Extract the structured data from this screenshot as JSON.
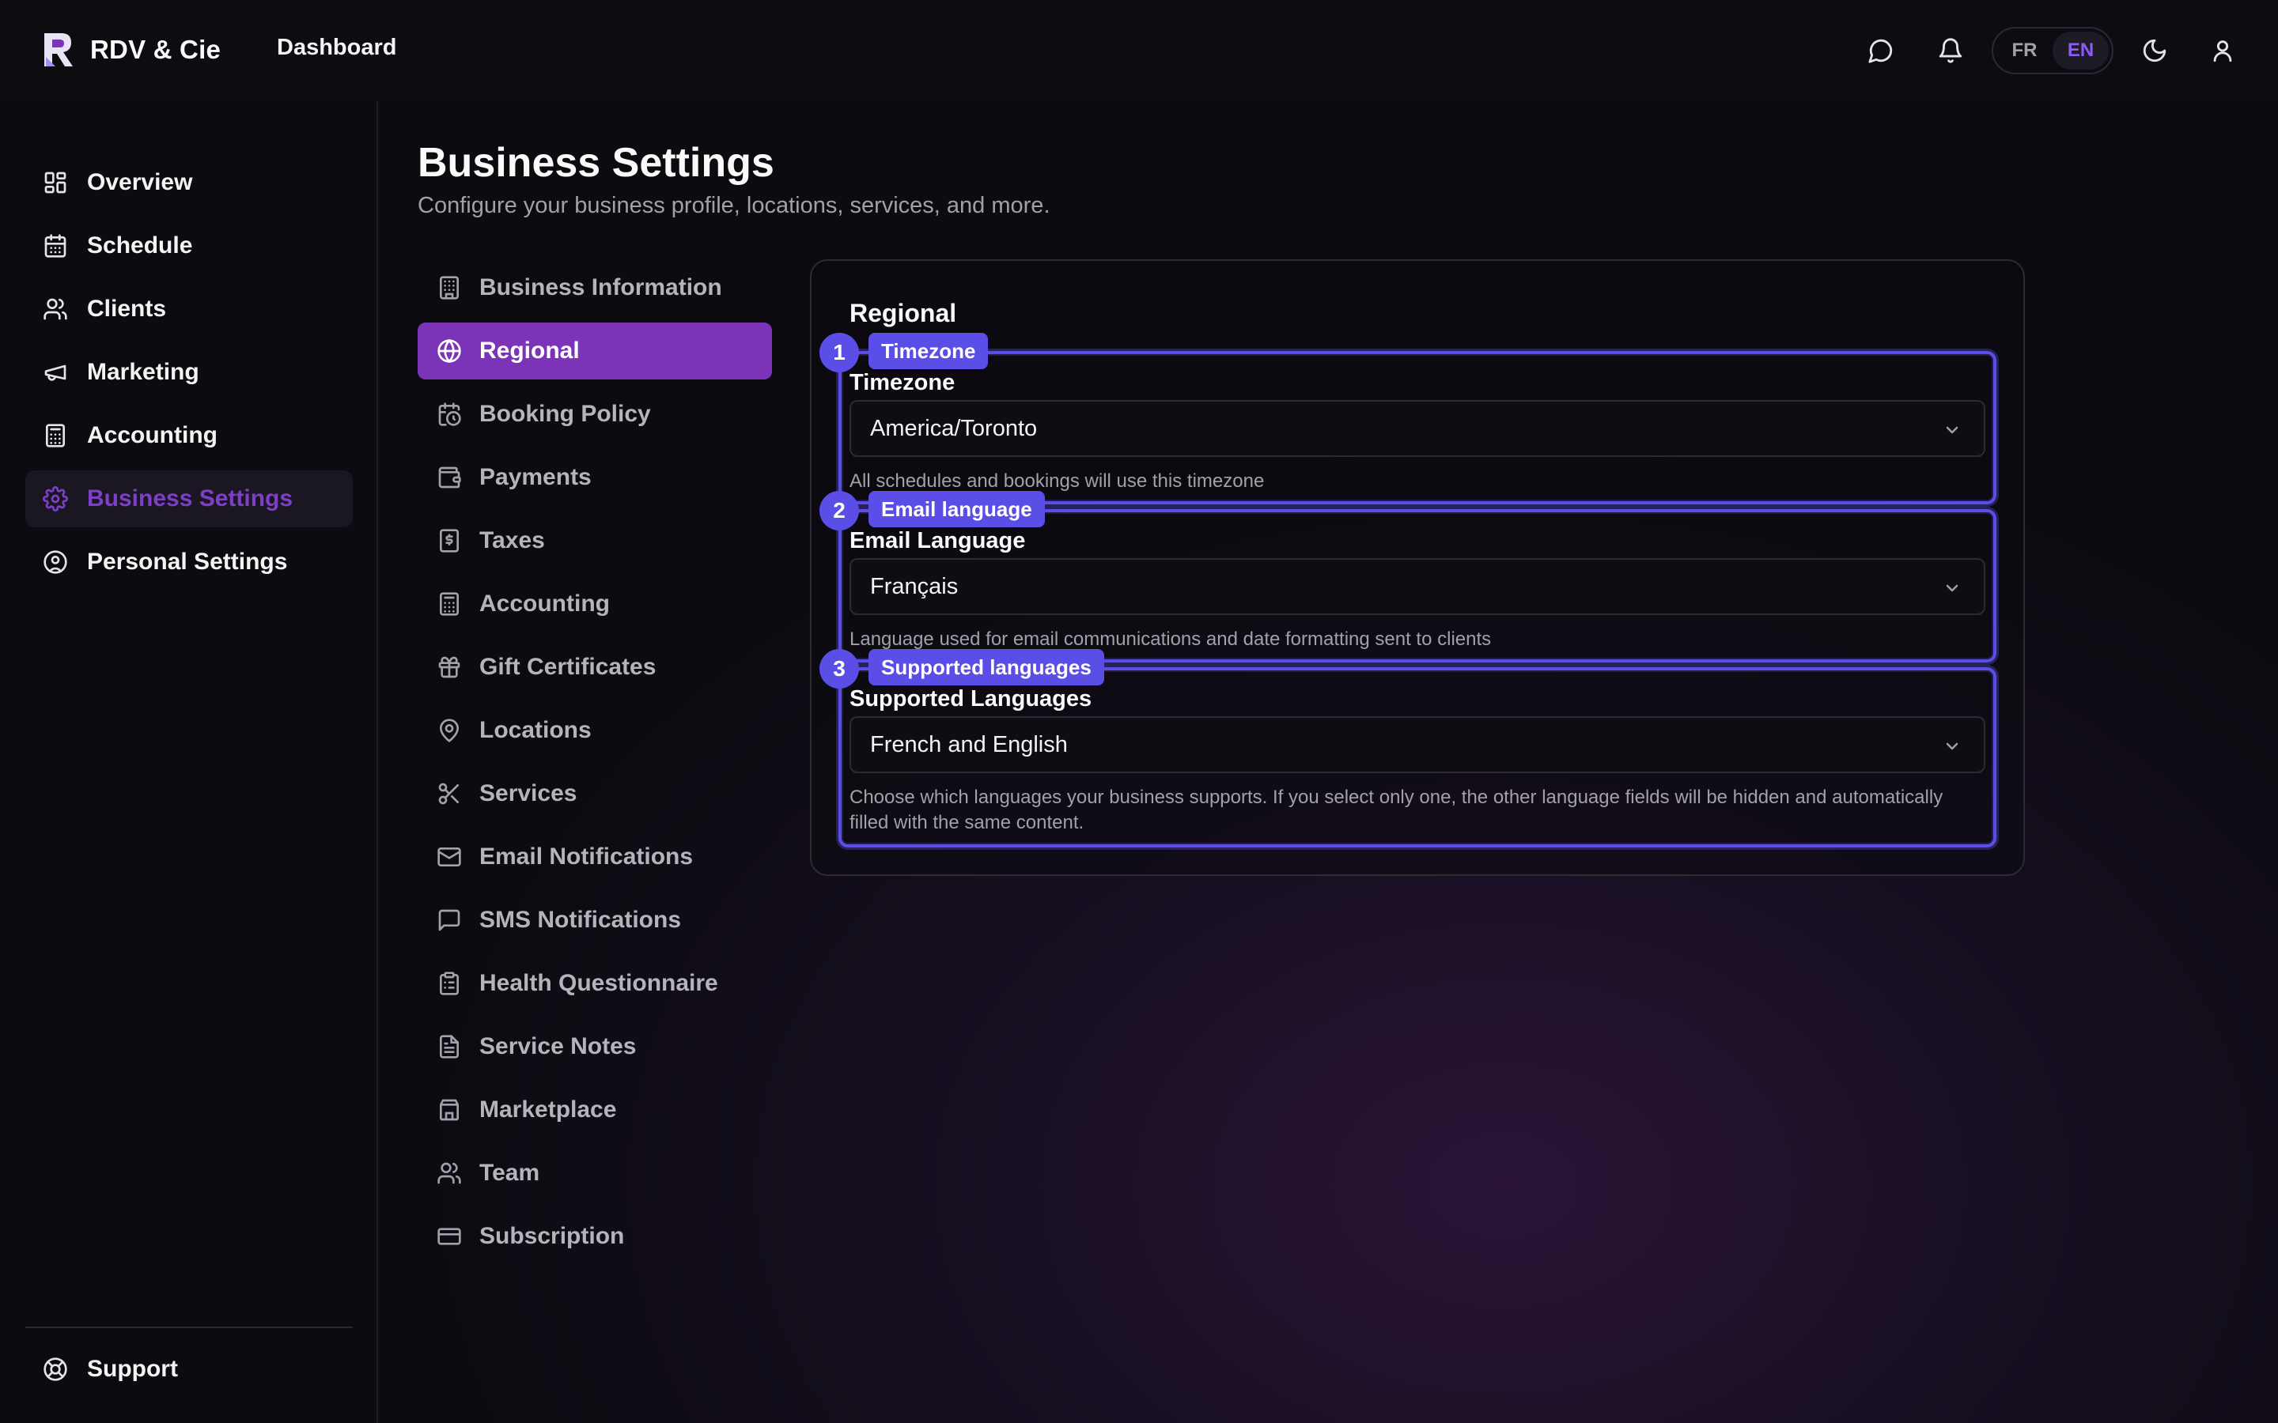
{
  "app": {
    "name": "RDV & Cie",
    "top_link": "Dashboard"
  },
  "header": {
    "lang": {
      "fr": "FR",
      "en": "EN",
      "selected": "EN"
    }
  },
  "sidebar": {
    "items": [
      {
        "label": "Overview",
        "icon": "layout-grid-icon"
      },
      {
        "label": "Schedule",
        "icon": "calendar-icon"
      },
      {
        "label": "Clients",
        "icon": "users-icon"
      },
      {
        "label": "Marketing",
        "icon": "megaphone-icon"
      },
      {
        "label": "Accounting",
        "icon": "calculator-icon"
      },
      {
        "label": "Business Settings",
        "icon": "gear-icon",
        "active": true
      },
      {
        "label": "Personal Settings",
        "icon": "user-circle-icon"
      }
    ],
    "support": "Support"
  },
  "page": {
    "title": "Business Settings",
    "subtitle": "Configure your business profile, locations, services, and more."
  },
  "settings_nav": [
    "Business Information",
    "Regional",
    "Booking Policy",
    "Payments",
    "Taxes",
    "Accounting",
    "Gift Certificates",
    "Locations",
    "Services",
    "Email Notifications",
    "SMS Notifications",
    "Health Questionnaire",
    "Service Notes",
    "Marketplace",
    "Team",
    "Subscription"
  ],
  "settings_nav_active": "Regional",
  "card": {
    "title": "Regional",
    "fields": [
      {
        "num": "1",
        "tag": "Timezone",
        "label": "Timezone",
        "value": "America/Toronto",
        "help": "All schedules and bookings will use this timezone"
      },
      {
        "num": "2",
        "tag": "Email language",
        "label": "Email Language",
        "value": "Français",
        "help": "Language used for email communications and date formatting sent to clients"
      },
      {
        "num": "3",
        "tag": "Supported languages",
        "label": "Supported Languages",
        "value": "French and English",
        "help": "Choose which languages your business supports. If you select only one, the other language fields will be hidden and automatically filled with the same content."
      }
    ]
  },
  "colors": {
    "accent": "#7b34b8",
    "highlight": "#5b4ee6",
    "active_text": "#7e3fc8"
  }
}
